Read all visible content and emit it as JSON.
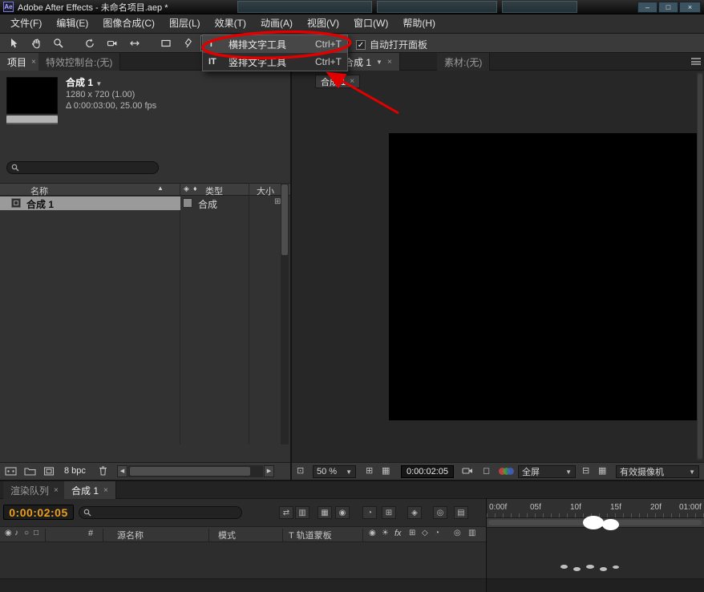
{
  "colors": {
    "annotation_red": "#e00000",
    "timecode_orange": "#ec9f1e",
    "panel_bg": "#323232",
    "viewport_black": "#000000"
  },
  "title_bar": {
    "app_icon": "Ae",
    "title": "Adobe After Effects - 未命名项目.aep *",
    "minimize": "–",
    "maximize": "□",
    "close": "×"
  },
  "menu_bar": {
    "items": [
      "文件(F)",
      "编辑(E)",
      "图像合成(C)",
      "图层(L)",
      "效果(T)",
      "动画(A)",
      "视图(V)",
      "窗口(W)",
      "帮助(H)"
    ]
  },
  "toolbar": {
    "text_tool_glyph": "T",
    "auto_open_panel": "自动打开面板"
  },
  "text_tool_menu": {
    "items": [
      {
        "icon": "T",
        "label": "横排文字工具",
        "shortcut": "Ctrl+T"
      },
      {
        "icon": "IT",
        "label": "竖排文字工具",
        "shortcut": "Ctrl+T"
      }
    ]
  },
  "project_panel": {
    "tab_project": "项目",
    "tab_effects": "特效控制台:(无)",
    "preview": {
      "comp_name": "合成 1",
      "resolution": "1280 x 720 (1.00)",
      "duration": "Δ 0:00:03:00, 25.00 fps"
    },
    "columns": {
      "name": "名称",
      "type": "类型",
      "size": "大小"
    },
    "rows": [
      {
        "name": "合成 1",
        "type": "合成"
      }
    ],
    "footer": {
      "bpc": "8 bpc"
    }
  },
  "composition_panel": {
    "tab_comp": "合成 1",
    "tab_footage": "素材:(无)",
    "viewer_tab": "合成 1",
    "zoom": "50 %",
    "timecode": "0:00:02:05",
    "resolution": "全屏",
    "camera_view": "有效摄像机"
  },
  "timeline_panel": {
    "tab_render_queue": "渲染队列",
    "tab_comp": "合成 1",
    "timecode": "0:00:02:05",
    "columns": {
      "index": "#",
      "source_name": "源名称",
      "mode": "模式",
      "trkmat": "T 轨道蒙板"
    },
    "fx": "fx",
    "ruler_labels": [
      "0:00f",
      "05f",
      "10f",
      "15f",
      "20f",
      "01:00f"
    ]
  }
}
